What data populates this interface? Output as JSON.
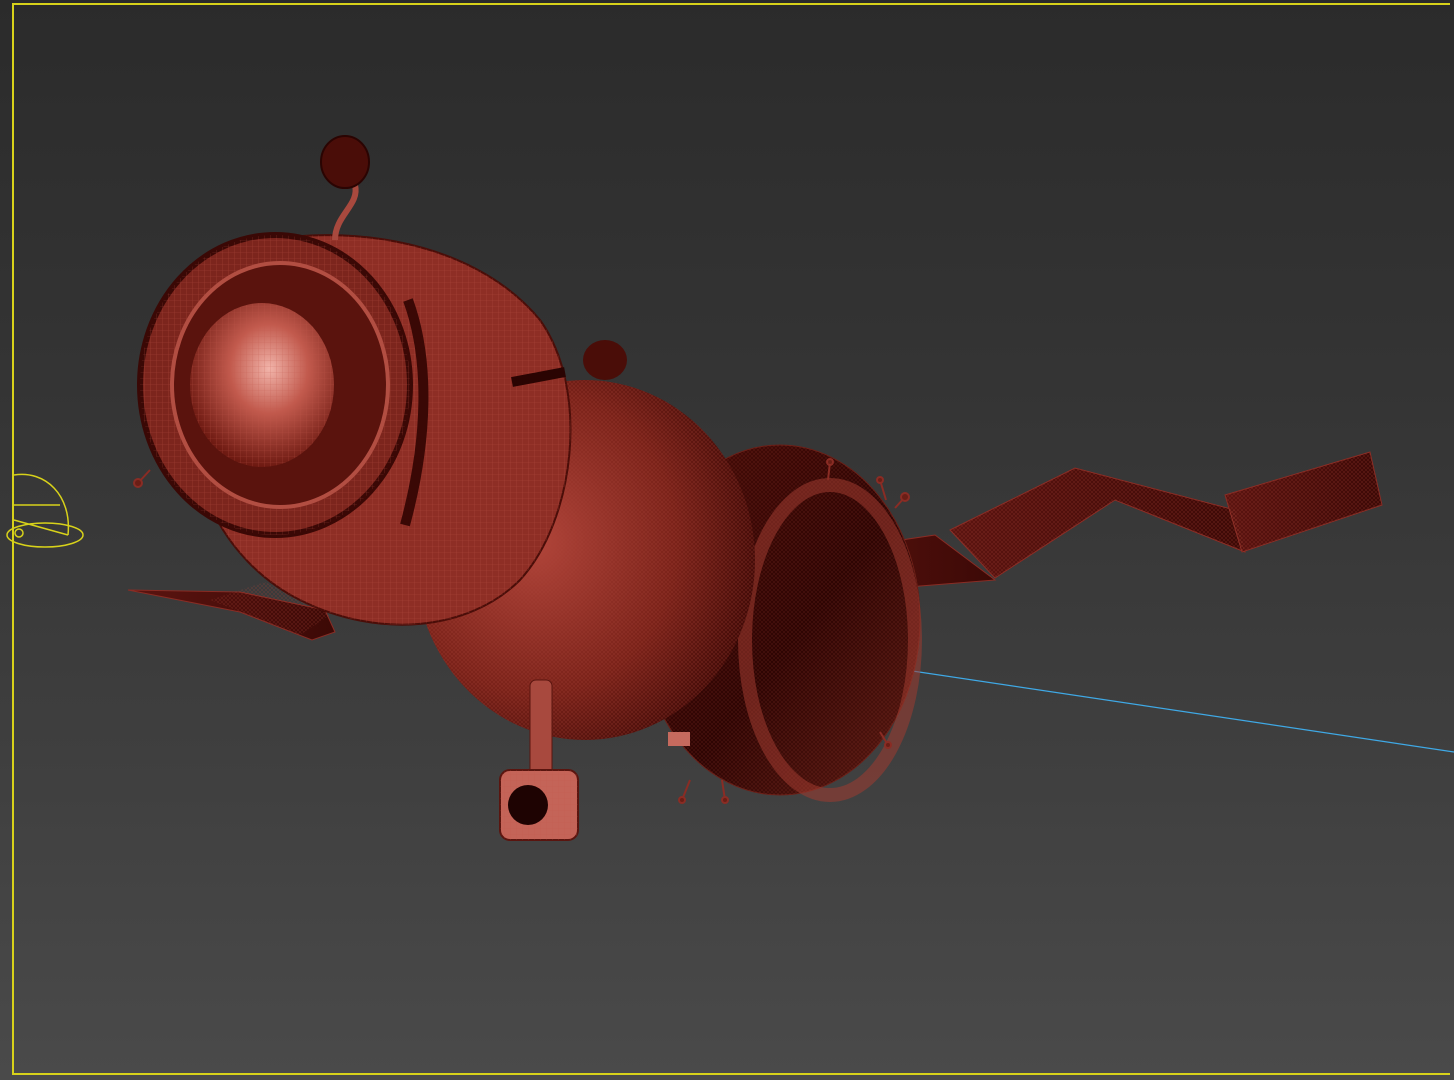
{
  "viewport": {
    "kind": "3d-perspective-viewport",
    "render_mode": "wireframe-on-shaded",
    "border_color": "#d8d21a",
    "model_color": "#8a2c24",
    "model_highlight": "#e0958a",
    "model_shadow": "#3a0805",
    "gizmo_color": "#d8d21a",
    "line_color": "#3fa9e6"
  },
  "scene": {
    "object": "spacecraft-model",
    "parts": [
      "descent-module",
      "orbital-module",
      "service-module",
      "solar-panel-left",
      "solar-panel-right",
      "antenna-dish",
      "docking-probe"
    ],
    "icons": [
      "camera-gizmo-icon"
    ]
  }
}
